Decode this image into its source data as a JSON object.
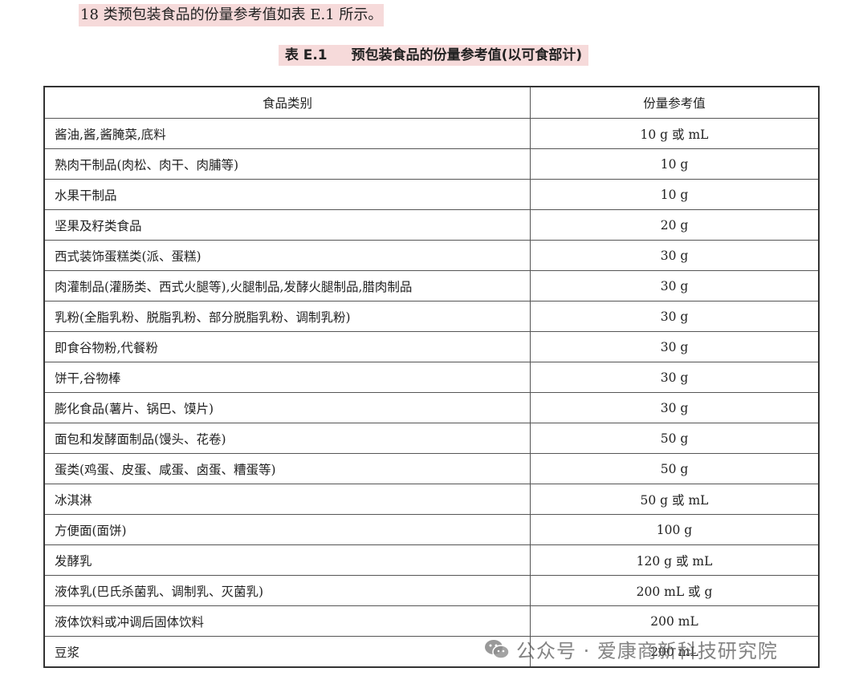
{
  "intro_text": "18 类预包装食品的份量参考值如表 E.1 所示。",
  "caption": {
    "number": "表 E.1",
    "title": "预包装食品的份量参考值(以可食部计)"
  },
  "table": {
    "headers": [
      "食品类别",
      "份量参考值"
    ],
    "rows": [
      {
        "category": "酱油,酱,酱腌菜,底料",
        "value": "10 g 或 mL"
      },
      {
        "category": "熟肉干制品(肉松、肉干、肉脯等)",
        "value": "10 g"
      },
      {
        "category": "水果干制品",
        "value": "10 g"
      },
      {
        "category": "坚果及籽类食品",
        "value": "20 g"
      },
      {
        "category": "西式装饰蛋糕类(派、蛋糕)",
        "value": "30 g"
      },
      {
        "category": "肉灌制品(灌肠类、西式火腿等),火腿制品,发酵火腿制品,腊肉制品",
        "value": "30 g"
      },
      {
        "category": "乳粉(全脂乳粉、脱脂乳粉、部分脱脂乳粉、调制乳粉)",
        "value": "30 g"
      },
      {
        "category": "即食谷物粉,代餐粉",
        "value": "30 g"
      },
      {
        "category": "饼干,谷物棒",
        "value": "30 g"
      },
      {
        "category": "膨化食品(薯片、锅巴、馍片)",
        "value": "30 g"
      },
      {
        "category": "面包和发酵面制品(馒头、花卷)",
        "value": "50 g"
      },
      {
        "category": "蛋类(鸡蛋、皮蛋、咸蛋、卤蛋、糟蛋等)",
        "value": "50 g"
      },
      {
        "category": "冰淇淋",
        "value": "50 g 或 mL"
      },
      {
        "category": "方便面(面饼)",
        "value": "100 g"
      },
      {
        "category": "发酵乳",
        "value": "120 g 或 mL"
      },
      {
        "category": "液体乳(巴氏杀菌乳、调制乳、灭菌乳)",
        "value": "200 mL 或 g"
      },
      {
        "category": "液体饮料或冲调后固体饮料",
        "value": "200 mL"
      },
      {
        "category": "豆浆",
        "value": "200 mL"
      }
    ]
  },
  "watermark": {
    "icon": "wechat-icon",
    "text": "公众号 · 爱康商新科技研究院"
  }
}
